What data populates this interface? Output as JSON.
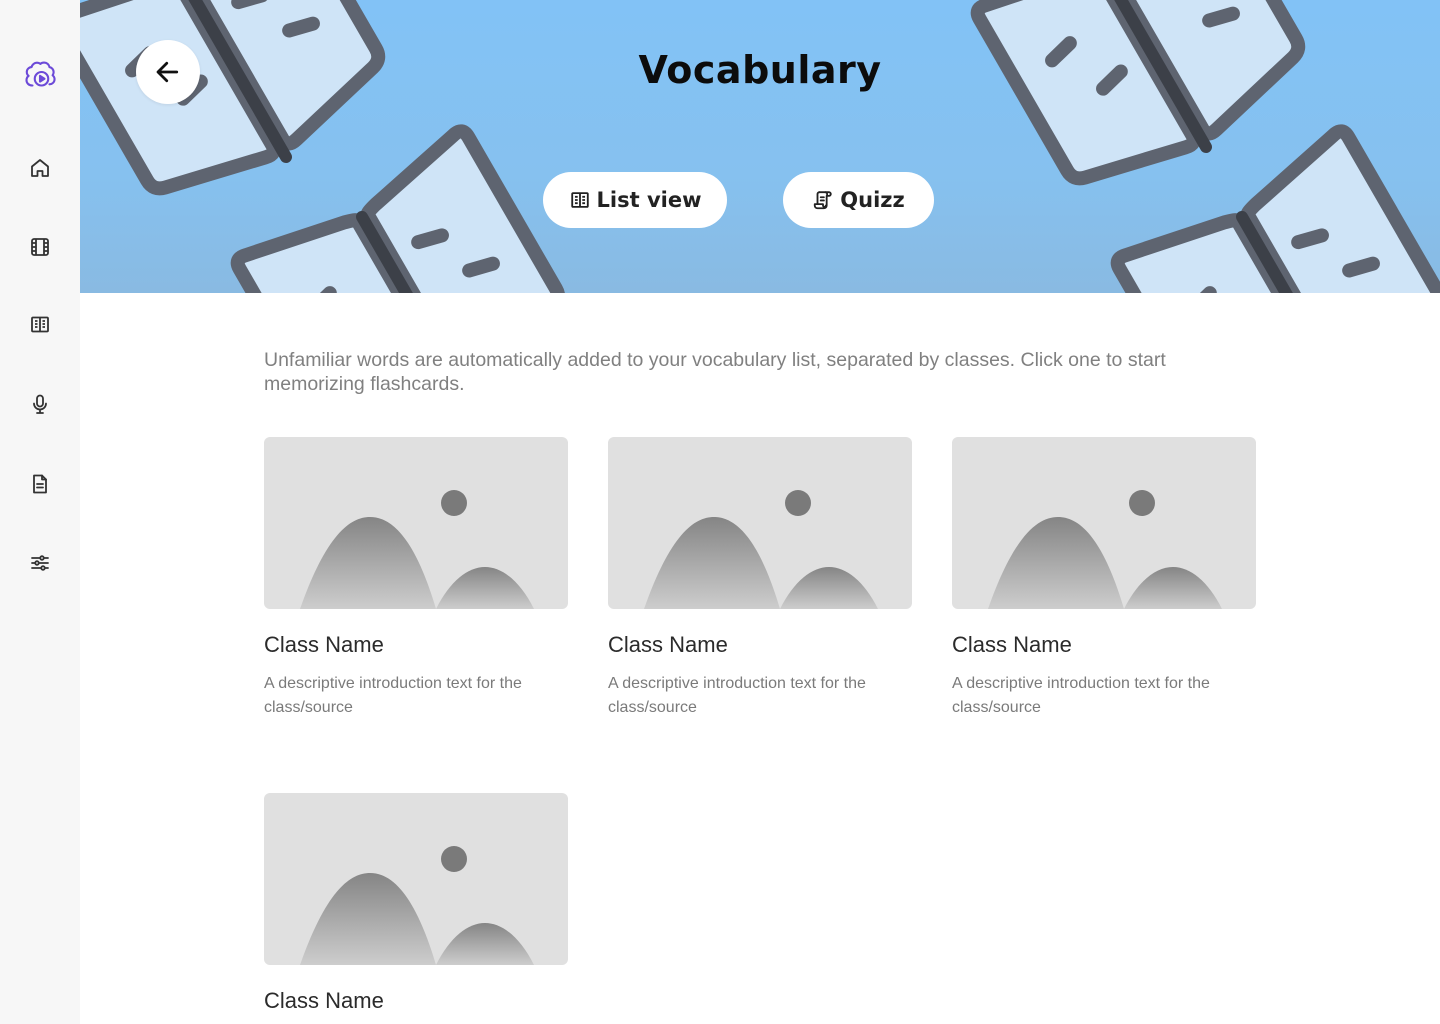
{
  "sidebar": {
    "items": [
      {
        "name": "logo",
        "icon": "brain-play-icon"
      },
      {
        "name": "home",
        "icon": "home-icon"
      },
      {
        "name": "videos",
        "icon": "film-icon"
      },
      {
        "name": "vocabulary",
        "icon": "book-open-icon"
      },
      {
        "name": "speaking",
        "icon": "microphone-icon"
      },
      {
        "name": "documents",
        "icon": "document-icon"
      },
      {
        "name": "settings",
        "icon": "sliders-icon"
      }
    ],
    "colors": {
      "logo": "#6c4ad8",
      "icon": "#333333",
      "background": "#f7f7f7"
    }
  },
  "header": {
    "title": "Vocabulary",
    "back_icon": "arrow-left-icon",
    "buttons": {
      "list_view": "List view",
      "quizz": "Quizz"
    },
    "colors": {
      "banner_top": "#82c2f6",
      "banner_bottom": "#89bae2"
    }
  },
  "main": {
    "intro": "Unfamiliar words are automatically added to your vocabulary list, separated by classes. Click one to start memorizing flashcards.",
    "cards": [
      {
        "title": "Class Name",
        "description": "A descriptive introduction text for the class/source"
      },
      {
        "title": "Class Name",
        "description": "A descriptive introduction text for the class/source"
      },
      {
        "title": "Class Name",
        "description": "A descriptive introduction text for the class/source"
      },
      {
        "title": "Class Name",
        "description": ""
      }
    ]
  }
}
